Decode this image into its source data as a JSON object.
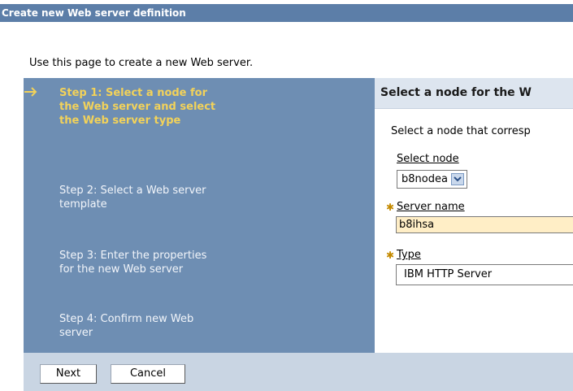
{
  "window": {
    "title": "Create new Web server definition"
  },
  "intro": "Use this page to create a new Web server.",
  "steps": [
    {
      "label": "Step 1: Select a node for the Web server and select the Web server type",
      "current": true
    },
    {
      "label": "Step 2: Select a Web server template",
      "current": false
    },
    {
      "label": "Step 3: Enter the properties for the new Web server",
      "current": false
    },
    {
      "label": "Step 4: Confirm new Web server",
      "current": false
    }
  ],
  "panel": {
    "title": "Select a node for the W",
    "description": "Select a node that corresp",
    "node_label": "Select node",
    "node_value": "b8nodea",
    "server_name_label": "Server name",
    "server_name_value": "b8ihsa",
    "type_label": "Type",
    "type_value": "IBM HTTP Server"
  },
  "buttons": {
    "next": "Next",
    "cancel": "Cancel"
  },
  "colors": {
    "title_bar": "#5c7ea8",
    "steps_panel": "#6e8eb3",
    "current_step": "#f2d25a",
    "required_input": "#ffeec6",
    "footer": "#c9d5e3"
  }
}
